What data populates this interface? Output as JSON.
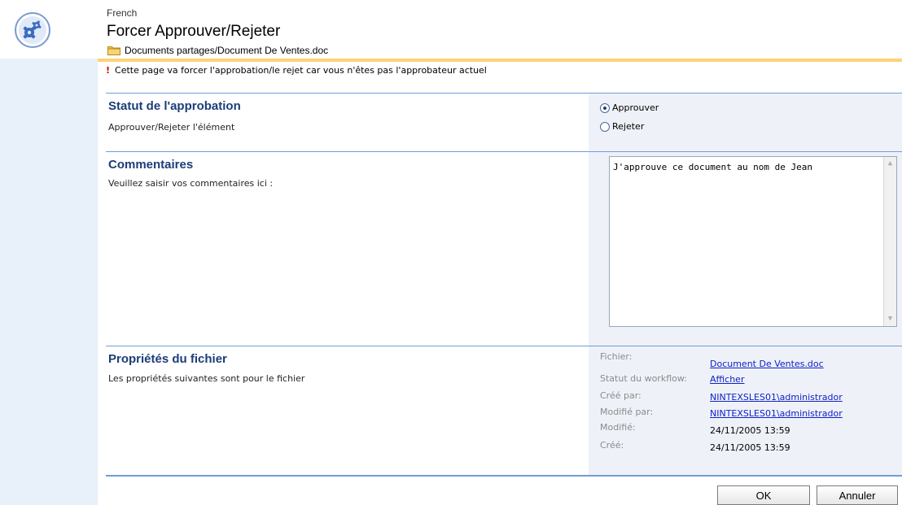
{
  "site": {
    "name": "French",
    "title": "Forcer Approuver/Rejeter",
    "breadcrumb": "Documents partages/Document De Ventes.doc"
  },
  "warning": {
    "text": "Cette page va forcer l'approbation/le rejet car vous n'êtes pas l'approbateur actuel"
  },
  "approval": {
    "title": "Statut de l'approbation",
    "description": "Approuver/Rejeter l'élément",
    "options": [
      {
        "label": "Approuver",
        "selected": true
      },
      {
        "label": "Rejeter",
        "selected": false
      }
    ]
  },
  "comments": {
    "title": "Commentaires",
    "description": "Veuillez saisir vos commentaires ici :",
    "value": "J'approuve ce document au nom de Jean"
  },
  "properties": {
    "title": "Propriétés du fichier",
    "description": "Les propriétés suivantes sont pour le fichier",
    "items": [
      {
        "label": "Fichier:",
        "value": "Document De Ventes.doc"
      },
      {
        "label": "Statut du workflow:",
        "value": "Afficher"
      },
      {
        "label": "Créé par:",
        "value": "NINTEXSLES01\\administrador"
      },
      {
        "label": "Modifié par:",
        "value": "NINTEXSLES01\\administrador"
      },
      {
        "label": "Modifié:",
        "value": "24/11/2005 13:59"
      },
      {
        "label": "Créé:",
        "value": "24/11/2005 13:59"
      }
    ]
  },
  "buttons": {
    "ok": "OK",
    "cancel": "Annuler"
  },
  "colors": {
    "accent": "#1c3d78",
    "rail": "#e8f0fa",
    "link": "#1020c8",
    "header_line": "#ffd275"
  },
  "icons": {
    "logo": "gears-icon",
    "breadcrumb": "folder-icon"
  }
}
